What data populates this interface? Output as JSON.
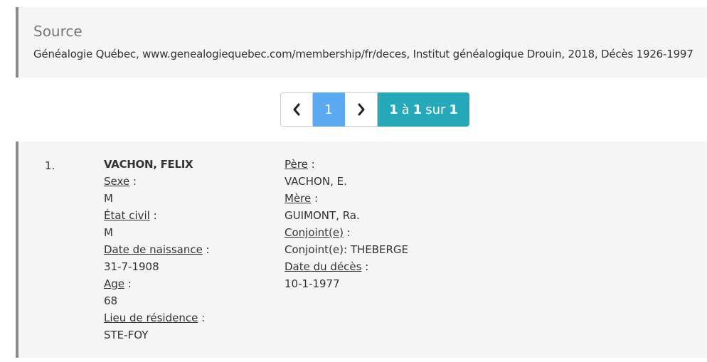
{
  "source": {
    "title": "Source",
    "text": "Généalogie Québec, www.genealogiequebec.com/membership/fr/deces, Institut généalogique Drouin, 2018, Décès 1926-1997"
  },
  "pagination": {
    "prev_icon": "chevron-left-icon",
    "next_icon": "chevron-right-icon",
    "current_page": "1",
    "range_start": "1",
    "range_word_a": "à",
    "range_end": "1",
    "range_word_sur": "sur",
    "range_total": "1"
  },
  "record": {
    "number": "1.",
    "name": "VACHON, FELIX",
    "sexe_label": "Sexe",
    "sexe_value": "M",
    "etat_label": "État civil",
    "etat_value": "M",
    "naissance_label": "Date de naissance",
    "naissance_value": "31-7-1908",
    "age_label": "Age",
    "age_value": "68",
    "residence_label": "Lieu de résidence",
    "residence_value": "STE-FOY",
    "pere_label": "Père",
    "pere_value": "VACHON, E.",
    "mere_label": "Mère",
    "mere_value": "GUIMONT, Ra.",
    "conjoint_label": "Conjoint(e)",
    "conjoint_value": "Conjoint(e): THEBERGE",
    "deces_label": "Date du décès",
    "deces_value": "10-1-1977",
    "colon": " :"
  }
}
